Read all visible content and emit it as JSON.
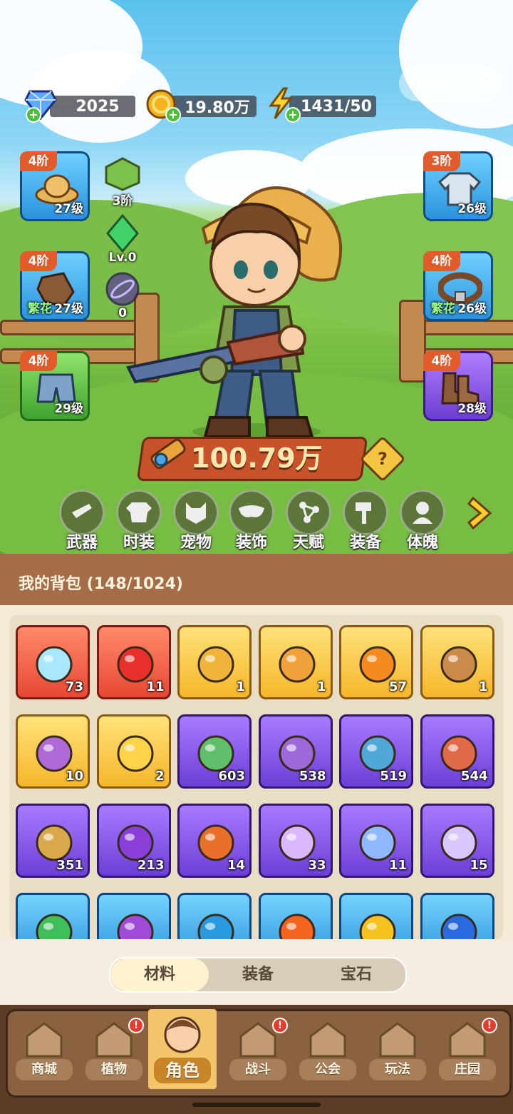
{
  "resources": {
    "diamond": "2025",
    "gold": "19.80万",
    "energy": "1431/50"
  },
  "equipment_left": [
    {
      "tier": "4阶",
      "level": "27级",
      "extra": ""
    },
    {
      "tier": "4阶",
      "level": "27级",
      "extra": "繁花"
    },
    {
      "tier": "4阶",
      "level": "29级",
      "extra": ""
    }
  ],
  "equipment_right": [
    {
      "tier": "3阶",
      "level": "26级",
      "extra": ""
    },
    {
      "tier": "4阶",
      "level": "26级",
      "extra": "繁花"
    },
    {
      "tier": "4阶",
      "level": "28级",
      "extra": ""
    }
  ],
  "minis": [
    {
      "label": "3阶"
    },
    {
      "label": "Lv.0"
    },
    {
      "label": "0"
    }
  ],
  "power": "100.79万",
  "help": "?",
  "nav": [
    "武器",
    "时装",
    "宠物",
    "装饰",
    "天赋",
    "装备",
    "体魄"
  ],
  "bag": {
    "title": "我的背包 (148/1024)",
    "items": [
      {
        "count": "73",
        "rarity": "red",
        "icon": "crystal-star-icon"
      },
      {
        "count": "11",
        "rarity": "red",
        "icon": "red-potion-icon"
      },
      {
        "count": "1",
        "rarity": "gold",
        "icon": "gold-key-icon"
      },
      {
        "count": "1",
        "rarity": "gold",
        "icon": "gem-key-icon"
      },
      {
        "count": "57",
        "rarity": "gold",
        "icon": "orange-potion-icon"
      },
      {
        "count": "1",
        "rarity": "gold",
        "icon": "flower-pot-icon"
      },
      {
        "count": "10",
        "rarity": "gold",
        "icon": "book-icon"
      },
      {
        "count": "2",
        "rarity": "gold",
        "icon": "golden-flower-icon"
      },
      {
        "count": "603",
        "rarity": "purple",
        "icon": "scroll-green-icon"
      },
      {
        "count": "538",
        "rarity": "purple",
        "icon": "scroll-purple-icon"
      },
      {
        "count": "519",
        "rarity": "purple",
        "icon": "scroll-blue-icon"
      },
      {
        "count": "544",
        "rarity": "purple",
        "icon": "scroll-red-icon"
      },
      {
        "count": "351",
        "rarity": "purple",
        "icon": "scroll-gold-icon"
      },
      {
        "count": "213",
        "rarity": "purple",
        "icon": "purple-potion-icon"
      },
      {
        "count": "14",
        "rarity": "purple",
        "icon": "fruit-bowl-icon"
      },
      {
        "count": "33",
        "rarity": "purple",
        "icon": "purple-crystal-icon"
      },
      {
        "count": "11",
        "rarity": "purple",
        "icon": "blue-crystal-icon"
      },
      {
        "count": "15",
        "rarity": "purple",
        "icon": "knot-emblem-icon"
      },
      {
        "count": "",
        "rarity": "blue",
        "icon": "green-orb-icon"
      },
      {
        "count": "",
        "rarity": "blue",
        "icon": "purple-orb-icon"
      },
      {
        "count": "",
        "rarity": "blue",
        "icon": "blue-orb-icon"
      },
      {
        "count": "",
        "rarity": "blue",
        "icon": "fire-orb-icon"
      },
      {
        "count": "",
        "rarity": "blue",
        "icon": "lightning-orb-icon"
      },
      {
        "count": "",
        "rarity": "blue",
        "icon": "blue-potion-icon"
      }
    ]
  },
  "tabs": [
    "材料",
    "装备",
    "宝石"
  ],
  "bottom_nav": [
    {
      "label": "商城",
      "badge": false
    },
    {
      "label": "植物",
      "badge": true
    },
    {
      "label": "角色",
      "badge": false
    },
    {
      "label": "战斗",
      "badge": true
    },
    {
      "label": "公会",
      "badge": false
    },
    {
      "label": "玩法",
      "badge": false
    },
    {
      "label": "庄园",
      "badge": true
    }
  ],
  "badge_mark": "!",
  "colors": {
    "tier_badge": "#e25b2b",
    "power_bar": "#c8532a",
    "active_tab": "#fff3cf"
  }
}
